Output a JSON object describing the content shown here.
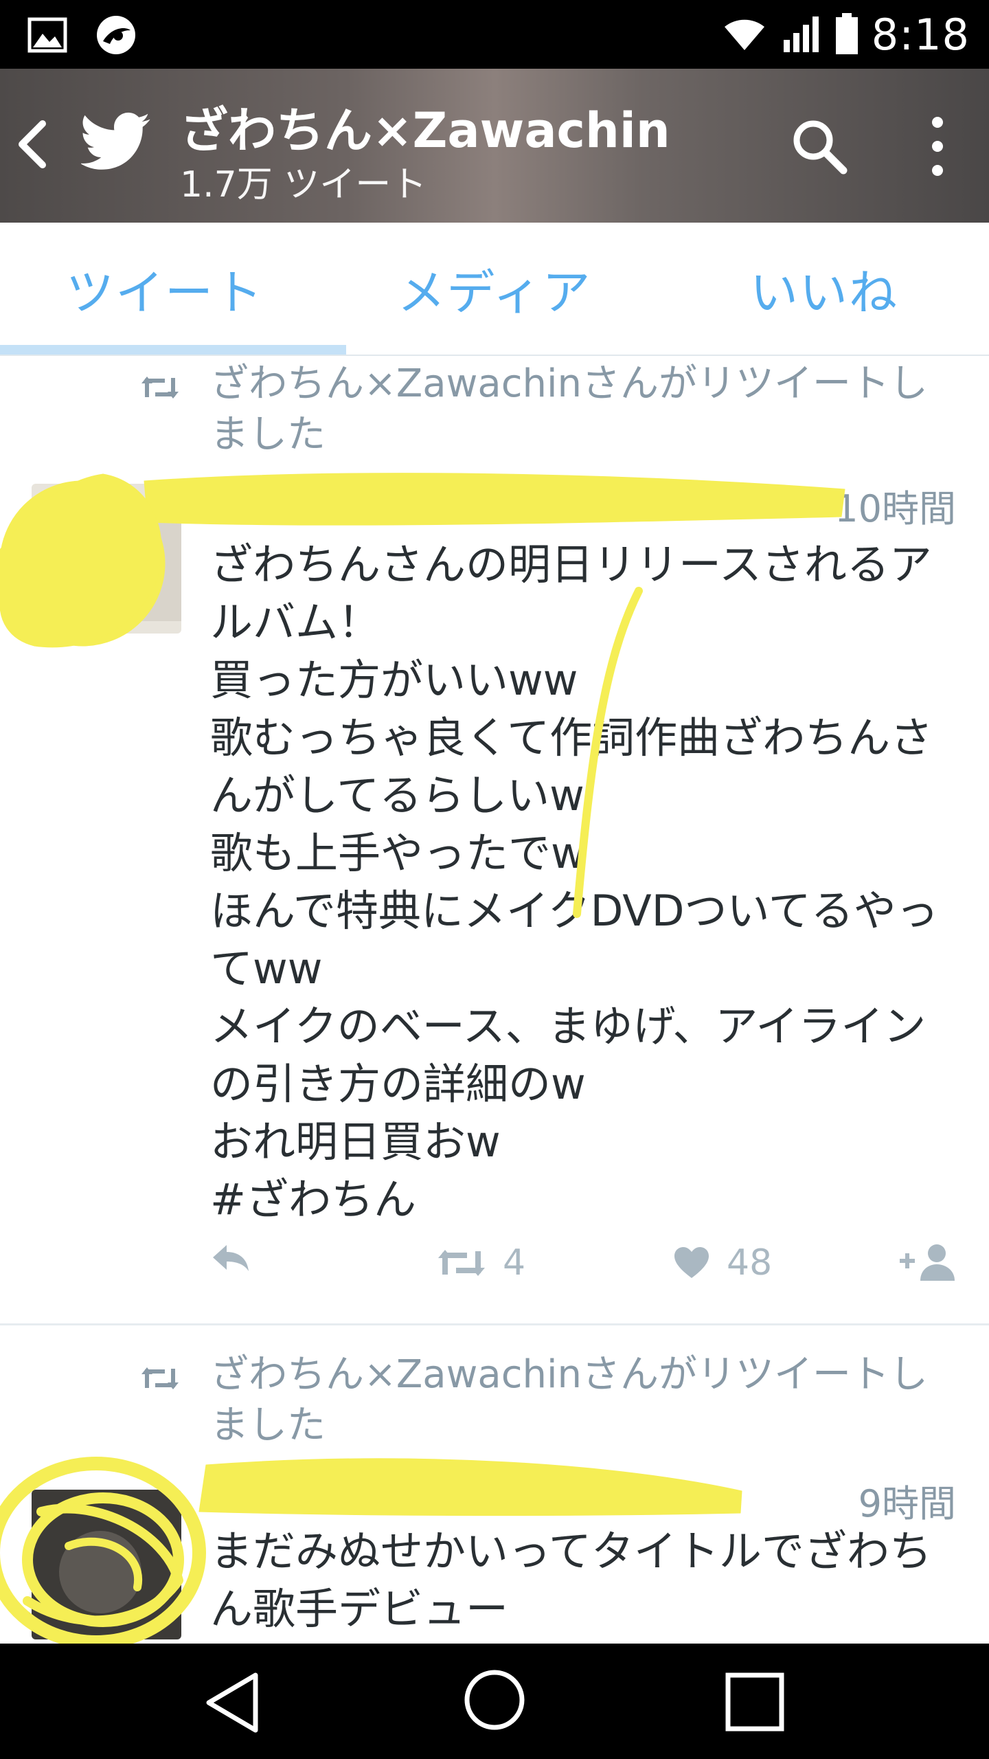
{
  "status_bar": {
    "time": "8:18",
    "icons": [
      "image-icon",
      "app-icon",
      "wifi-icon",
      "signal-icon",
      "battery-icon"
    ]
  },
  "header": {
    "title": "ざわちん×Zawachin",
    "subtitle": "1.7万 ツイート",
    "icons": [
      "back-icon",
      "twitter-bird-icon",
      "search-icon",
      "more-icon"
    ]
  },
  "tabs": [
    {
      "label": "ツイート",
      "active": true
    },
    {
      "label": "メディア",
      "active": false
    },
    {
      "label": "いいね",
      "active": false
    }
  ],
  "tweets": [
    {
      "retweet_label": "ざわちん×Zawachinさんがリツイートしました",
      "time": "10時間",
      "body": "ざわちんさんの明日リリースされるアルバム！\n買った方がいいww\n歌むっちゃ良くて作詞作曲ざわちんさんがしてるらしいw\n歌も上手やったでw\nほんで特典にメイクDVDついてるやってww\nメイクのベース、まゆげ、アイラインの引き方の詳細のw\nおれ明日買おw\n#ざわちん",
      "retweets": "4",
      "likes": "48"
    },
    {
      "retweet_label": "ざわちん×Zawachinさんがリツイートしました",
      "time": "9時間",
      "body": "まだみぬせかいってタイトルでざわちん歌手デビュー"
    }
  ],
  "colors": {
    "accent": "#55acee",
    "muted": "#8899a6",
    "scribble": "#f5ee55"
  }
}
